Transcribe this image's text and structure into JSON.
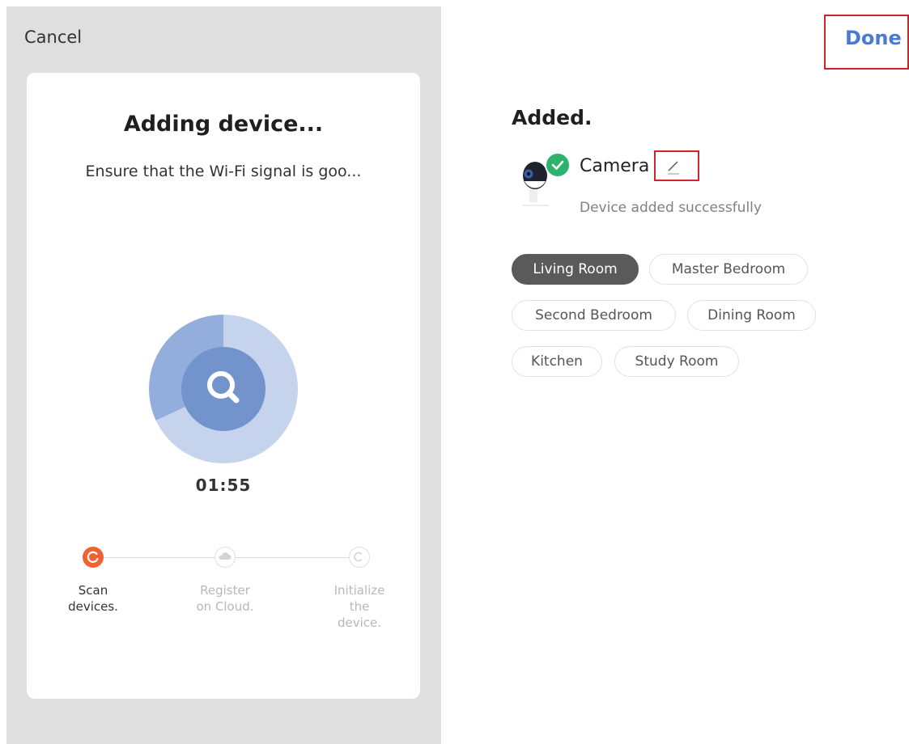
{
  "left": {
    "cancel_label": "Cancel",
    "title": "Adding device...",
    "subtitle": "Ensure that the Wi-Fi signal is goo...",
    "timer": "01:55",
    "steps": [
      {
        "line1": "Scan",
        "line2": "devices.",
        "line3": "",
        "state": "active"
      },
      {
        "line1": "Register",
        "line2": "on Cloud.",
        "line3": "",
        "state": "pending"
      },
      {
        "line1": "Initialize",
        "line2": "the",
        "line3": "device.",
        "state": "pending"
      }
    ]
  },
  "right": {
    "done_label": "Done",
    "title": "Added.",
    "device_name": "Camera",
    "device_status": "Device added successfully",
    "rooms": [
      "Living Room",
      "Master Bedroom",
      "Second Bedroom",
      "Dining Room",
      "Kitchen",
      "Study Room"
    ],
    "selected_room": "Living Room"
  },
  "colors": {
    "accent_blue": "#4a7bd0",
    "active_step": "#f06232",
    "success_green": "#2db36e",
    "highlight_red": "#d0232a"
  },
  "icons": [
    "search-icon",
    "cloud-icon",
    "initialize-icon",
    "camera-icon",
    "check-icon",
    "pencil-icon"
  ]
}
